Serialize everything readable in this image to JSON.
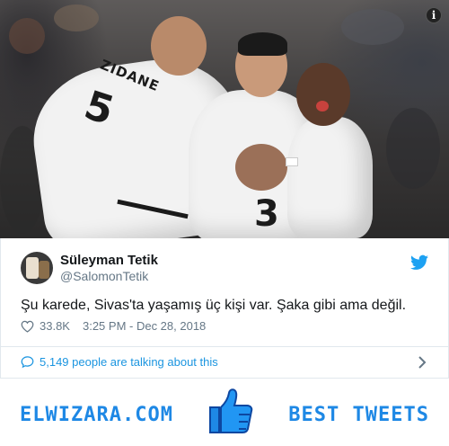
{
  "photo": {
    "alt_icon": "i",
    "jersey_name": "ZIDANE",
    "jersey_number_left": "5",
    "jersey_number_center": "3"
  },
  "tweet": {
    "display_name": "Süleyman Tetik",
    "handle": "@SalomonTetik",
    "text": "Şu karede, Sivas'ta yaşamış üç kişi var. Şaka gibi ama değil.",
    "likes": "33.8K",
    "timestamp": "3:25 PM - Dec 28, 2018",
    "talking": "5,149 people are talking about this"
  },
  "footer": {
    "brand_left": "ELWIZARA.COM",
    "brand_right": "BEST TWEETS"
  },
  "colors": {
    "twitter_blue": "#1da1f2",
    "link_blue": "#1b95e0",
    "brand_blue": "#1e88e5",
    "muted": "#657786"
  }
}
